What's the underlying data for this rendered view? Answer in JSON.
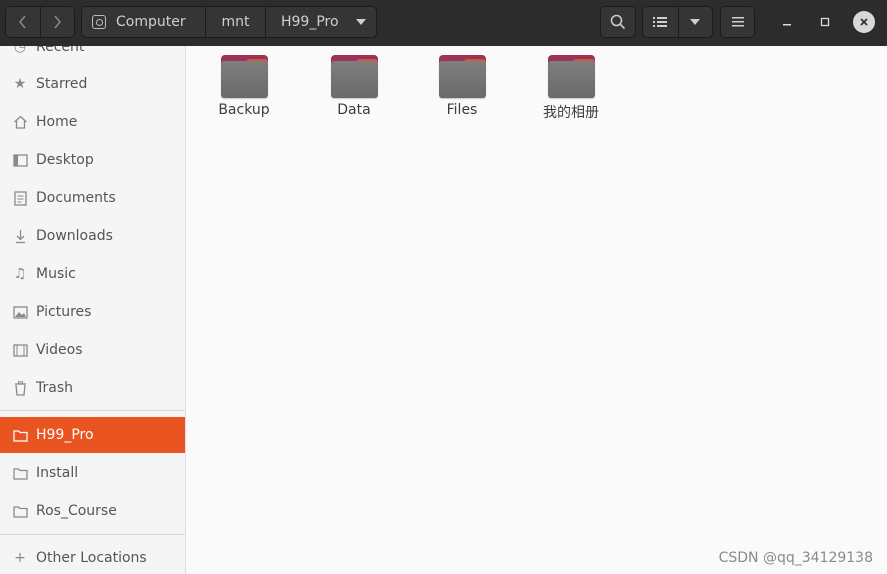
{
  "header": {
    "breadcrumbs": [
      "Computer",
      "mnt",
      "H99_Pro"
    ],
    "icons": {
      "back": "chevron-left-icon",
      "forward": "chevron-right-icon",
      "search": "search-icon",
      "list_view": "list-view-icon",
      "view_options": "triangle-down-icon",
      "menu": "hamburger-icon",
      "minimize": "minimize-icon",
      "maximize": "maximize-icon",
      "close": "close-icon"
    }
  },
  "sidebar": {
    "places": [
      {
        "label": "Recent",
        "icon": "clock-icon"
      },
      {
        "label": "Starred",
        "icon": "star-icon"
      },
      {
        "label": "Home",
        "icon": "home-icon"
      },
      {
        "label": "Desktop",
        "icon": "desktop-icon"
      },
      {
        "label": "Documents",
        "icon": "document-icon"
      },
      {
        "label": "Downloads",
        "icon": "download-icon"
      },
      {
        "label": "Music",
        "icon": "music-icon"
      },
      {
        "label": "Pictures",
        "icon": "picture-icon"
      },
      {
        "label": "Videos",
        "icon": "video-icon"
      },
      {
        "label": "Trash",
        "icon": "trash-icon"
      }
    ],
    "bookmarks": [
      {
        "label": "H99_Pro",
        "icon": "folder-icon",
        "active": true
      },
      {
        "label": "Install",
        "icon": "folder-icon",
        "active": false
      },
      {
        "label": "Ros_Course",
        "icon": "folder-icon",
        "active": false
      }
    ],
    "other": {
      "label": "Other Locations",
      "icon": "plus-icon"
    }
  },
  "content": {
    "folders": [
      "Backup",
      "Data",
      "Files",
      "我的相册"
    ]
  },
  "watermark": "CSDN @qq_34129138",
  "colors": {
    "accent": "#e95420",
    "headerbar": "#2c2c2c",
    "folder_body": "#757575",
    "folder_tab": "#9a3557"
  }
}
